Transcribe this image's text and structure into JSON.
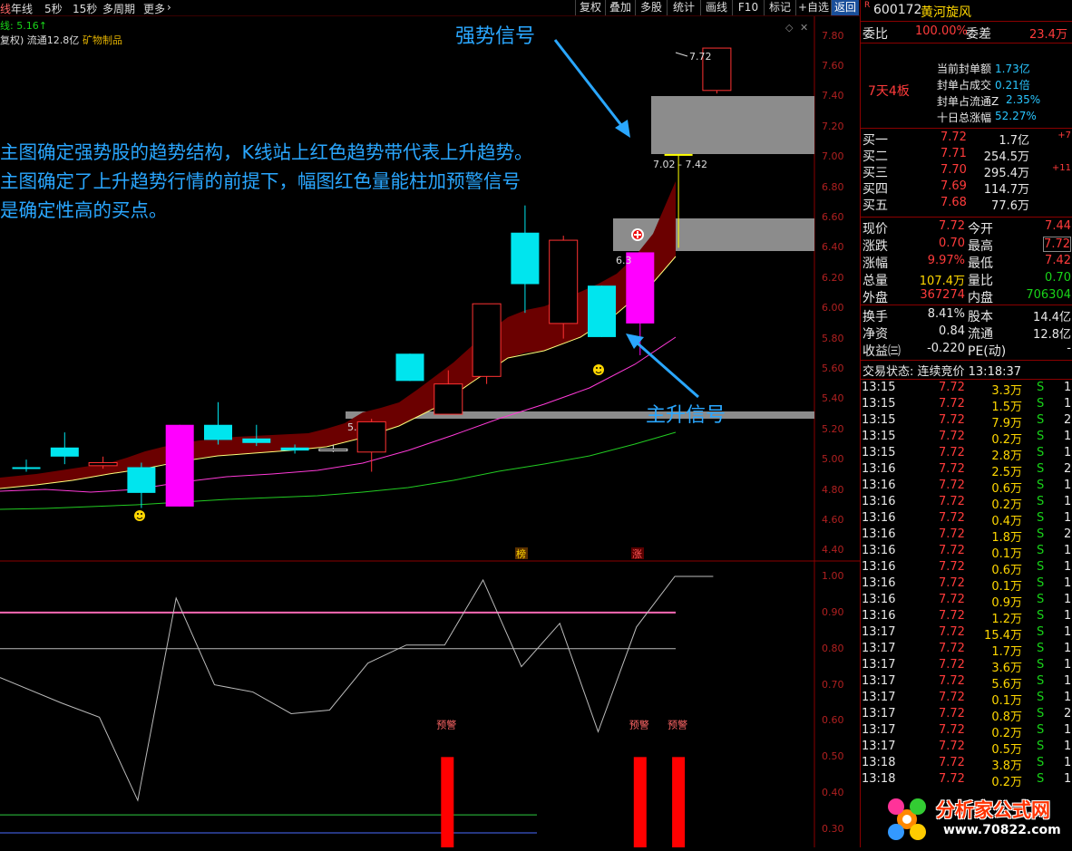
{
  "toolbar": {
    "left_items": [
      "线",
      "年线",
      "5秒",
      "15秒",
      "多周期",
      "更多"
    ],
    "buttons": [
      "复权",
      "叠加",
      "多股",
      "统计",
      "画线",
      "F10",
      "标记",
      "+自选",
      "返回"
    ]
  },
  "info": {
    "line1": "线: 5.16↑",
    "line2_a": "复权) 流通12.8亿",
    "line2_b": "矿物制品"
  },
  "annotations": {
    "strong_signal": "强势信号",
    "main_rise_signal": "主升信号",
    "para_1": "主图确定强势股的趋势结构，K线站上红色趋势带代表上升趋势。",
    "para_2": "主图确定了上升趋势行情的前提下，幅图红色量能柱加预警信号",
    "para_3": "是确定性高的买点。"
  },
  "colors": {
    "up_box": "#00e5ee",
    "magenta": "#ff00ff",
    "yellow_box": "#ffff00",
    "trend_band": "#6b0000",
    "annotation": "#2aa7ff",
    "alert_bar": "#ff0000"
  },
  "chart_data": [
    {
      "type": "candlestick",
      "title": "",
      "y_ticks": [
        "7.80",
        "7.60",
        "7.40",
        "7.20",
        "7.00",
        "6.80",
        "6.60",
        "6.40",
        "6.20",
        "6.00",
        "5.80",
        "5.60",
        "5.40",
        "5.20",
        "5.00",
        "4.80",
        "4.60",
        "4.40"
      ],
      "ylim": [
        4.33,
        7.93
      ],
      "candles": [
        {
          "o": 4.95,
          "c": 4.95,
          "h": 5.0,
          "l": 4.92,
          "color": "cyan"
        },
        {
          "o": 5.02,
          "c": 5.08,
          "h": 5.18,
          "l": 4.97,
          "color": "cyan"
        },
        {
          "o": 4.98,
          "c": 4.96,
          "h": 5.02,
          "l": 4.94,
          "color": "red"
        },
        {
          "o": 4.95,
          "c": 4.78,
          "h": 4.98,
          "l": 4.68,
          "color": "cyan"
        },
        {
          "o": 4.69,
          "c": 5.23,
          "h": 5.23,
          "l": 4.69,
          "color": "magenta"
        },
        {
          "o": 5.23,
          "c": 5.13,
          "h": 5.38,
          "l": 5.1,
          "color": "cyan"
        },
        {
          "o": 5.14,
          "c": 5.11,
          "h": 5.23,
          "l": 5.09,
          "color": "cyan"
        },
        {
          "o": 5.08,
          "c": 5.06,
          "h": 5.1,
          "l": 5.04,
          "color": "cyan"
        },
        {
          "o": 5.07,
          "c": 5.07,
          "h": 5.1,
          "l": 5.05,
          "color": "white"
        },
        {
          "o": 5.05,
          "c": 5.25,
          "h": 5.27,
          "l": 4.92,
          "color": "red"
        },
        {
          "o": 5.7,
          "c": 5.52,
          "h": 5.7,
          "l": 5.52,
          "color": "cyan"
        },
        {
          "o": 5.3,
          "c": 5.5,
          "h": 5.59,
          "l": 5.3,
          "color": "red"
        },
        {
          "o": 5.55,
          "c": 6.03,
          "h": 6.03,
          "l": 5.5,
          "color": "red"
        },
        {
          "o": 6.5,
          "c": 6.16,
          "h": 6.68,
          "l": 5.97,
          "color": "cyan"
        },
        {
          "o": 5.9,
          "c": 6.45,
          "h": 6.48,
          "l": 5.8,
          "color": "red"
        },
        {
          "o": 6.15,
          "c": 5.81,
          "h": 6.15,
          "l": 5.81,
          "color": "cyan"
        },
        {
          "o": 5.9,
          "c": 6.37,
          "h": 6.37,
          "l": 5.69,
          "color": "magenta"
        },
        {
          "o": 7.02,
          "c": 7.02,
          "h": 7.02,
          "l": 6.4,
          "color": "yellow"
        },
        {
          "o": 7.44,
          "c": 7.72,
          "h": 7.72,
          "l": 7.42,
          "color": "red"
        }
      ],
      "price_labels": [
        "7.72",
        "7.02 - 7.42",
        "6.3",
        "5."
      ],
      "signal_markers": [
        "榜",
        "涨"
      ],
      "legend": "none",
      "grid": false
    },
    {
      "type": "line",
      "title": "",
      "y_ticks": [
        "1.00",
        "0.90",
        "0.80",
        "0.70",
        "0.60",
        "0.50",
        "0.40",
        "0.30"
      ],
      "ylim": [
        0.25,
        1.04
      ],
      "series": [
        {
          "values": [
            0.72,
            0.65,
            0.61,
            0.38,
            0.94,
            0.7,
            0.68,
            0.62,
            0.63,
            0.76,
            0.81,
            0.81,
            0.99,
            0.75,
            0.87,
            0.57,
            0.86,
            1.0,
            1.0
          ],
          "color": "#bbbbbb"
        }
      ],
      "ref_lines": [
        {
          "value": 0.9,
          "color": "#ff69b4"
        },
        {
          "value": 0.8,
          "color": "#bbbbbb"
        },
        {
          "value": 0.34,
          "color": "#2ecc40"
        },
        {
          "value": 0.29,
          "color": "#4a6cff"
        }
      ],
      "alert_label": "预警",
      "alert_bars_at": [
        11,
        16,
        17
      ]
    }
  ],
  "right_panel": {
    "code": "600172",
    "name": "黄河旋风",
    "r_mark": "R",
    "weibi_label": "委比",
    "weibi_value": "100.00%",
    "weicha_label": "委差",
    "weicha_value": "23.4万",
    "board_label": "7天4板",
    "seal_rows": [
      {
        "label": "当前封单额",
        "value": "1.73亿"
      },
      {
        "label": "封单占成交",
        "value": "0.21倍"
      },
      {
        "label": "封单占流通Z",
        "value": "2.35%"
      },
      {
        "label": "十日总涨幅",
        "value": "52.27%"
      }
    ],
    "bids": [
      {
        "label": "买一",
        "price": "7.72",
        "vol": "1.7亿",
        "extra": "+7"
      },
      {
        "label": "买二",
        "price": "7.71",
        "vol": "254.5万",
        "extra": ""
      },
      {
        "label": "买三",
        "price": "7.70",
        "vol": "295.4万",
        "extra": "+11"
      },
      {
        "label": "买四",
        "price": "7.69",
        "vol": "114.7万",
        "extra": ""
      },
      {
        "label": "买五",
        "price": "7.68",
        "vol": "77.6万",
        "extra": ""
      }
    ],
    "quote": [
      {
        "l1": "现价",
        "v1": "7.72",
        "l2": "今开",
        "v2": "7.44"
      },
      {
        "l1": "涨跌",
        "v1": "0.70",
        "l2": "最高",
        "v2": "7.72"
      },
      {
        "l1": "涨幅",
        "v1": "9.97%",
        "l2": "最低",
        "v2": "7.42"
      },
      {
        "l1": "总量",
        "v1": "107.4万",
        "l2": "量比",
        "v2": "0.70"
      },
      {
        "l1": "外盘",
        "v1": "367274",
        "l2": "内盘",
        "v2": "706304"
      }
    ],
    "stats": [
      {
        "l1": "换手",
        "v1": "8.41%",
        "l2": "股本",
        "v2": "14.4亿"
      },
      {
        "l1": "净资",
        "v1": "0.84",
        "l2": "流通",
        "v2": "12.8亿"
      },
      {
        "l1": "收益㈢",
        "v1": "-0.220",
        "l2": "PE(动)",
        "v2": "-"
      }
    ],
    "trade_status": "交易状态: 连续竞价 13:18:37",
    "trades": [
      {
        "t": "13:15",
        "p": "7.72",
        "v": "3.3万",
        "s": "S",
        "n": "1"
      },
      {
        "t": "13:15",
        "p": "7.72",
        "v": "1.5万",
        "s": "S",
        "n": "1"
      },
      {
        "t": "13:15",
        "p": "7.72",
        "v": "7.9万",
        "s": "S",
        "n": "2"
      },
      {
        "t": "13:15",
        "p": "7.72",
        "v": "0.2万",
        "s": "S",
        "n": "1"
      },
      {
        "t": "13:15",
        "p": "7.72",
        "v": "2.8万",
        "s": "S",
        "n": "1"
      },
      {
        "t": "13:16",
        "p": "7.72",
        "v": "2.5万",
        "s": "S",
        "n": "2"
      },
      {
        "t": "13:16",
        "p": "7.72",
        "v": "0.6万",
        "s": "S",
        "n": "1"
      },
      {
        "t": "13:16",
        "p": "7.72",
        "v": "0.2万",
        "s": "S",
        "n": "1"
      },
      {
        "t": "13:16",
        "p": "7.72",
        "v": "0.4万",
        "s": "S",
        "n": "1"
      },
      {
        "t": "13:16",
        "p": "7.72",
        "v": "1.8万",
        "s": "S",
        "n": "2"
      },
      {
        "t": "13:16",
        "p": "7.72",
        "v": "0.1万",
        "s": "S",
        "n": "1"
      },
      {
        "t": "13:16",
        "p": "7.72",
        "v": "0.6万",
        "s": "S",
        "n": "1"
      },
      {
        "t": "13:16",
        "p": "7.72",
        "v": "0.1万",
        "s": "S",
        "n": "1"
      },
      {
        "t": "13:16",
        "p": "7.72",
        "v": "0.9万",
        "s": "S",
        "n": "1"
      },
      {
        "t": "13:16",
        "p": "7.72",
        "v": "1.2万",
        "s": "S",
        "n": "1"
      },
      {
        "t": "13:17",
        "p": "7.72",
        "v": "15.4万",
        "s": "S",
        "n": "1"
      },
      {
        "t": "13:17",
        "p": "7.72",
        "v": "1.7万",
        "s": "S",
        "n": "1"
      },
      {
        "t": "13:17",
        "p": "7.72",
        "v": "3.6万",
        "s": "S",
        "n": "1"
      },
      {
        "t": "13:17",
        "p": "7.72",
        "v": "5.6万",
        "s": "S",
        "n": "1"
      },
      {
        "t": "13:17",
        "p": "7.72",
        "v": "0.1万",
        "s": "S",
        "n": "1"
      },
      {
        "t": "13:17",
        "p": "7.72",
        "v": "0.8万",
        "s": "S",
        "n": "2"
      },
      {
        "t": "13:17",
        "p": "7.72",
        "v": "0.2万",
        "s": "S",
        "n": "1"
      },
      {
        "t": "13:17",
        "p": "7.72",
        "v": "0.5万",
        "s": "S",
        "n": "1"
      },
      {
        "t": "13:18",
        "p": "7.72",
        "v": "3.8万",
        "s": "S",
        "n": "1"
      },
      {
        "t": "13:18",
        "p": "7.72",
        "v": "0.2万",
        "s": "S",
        "n": "1"
      }
    ]
  },
  "watermark": {
    "brand": "分析家公式网",
    "url": "www.70822.com"
  }
}
